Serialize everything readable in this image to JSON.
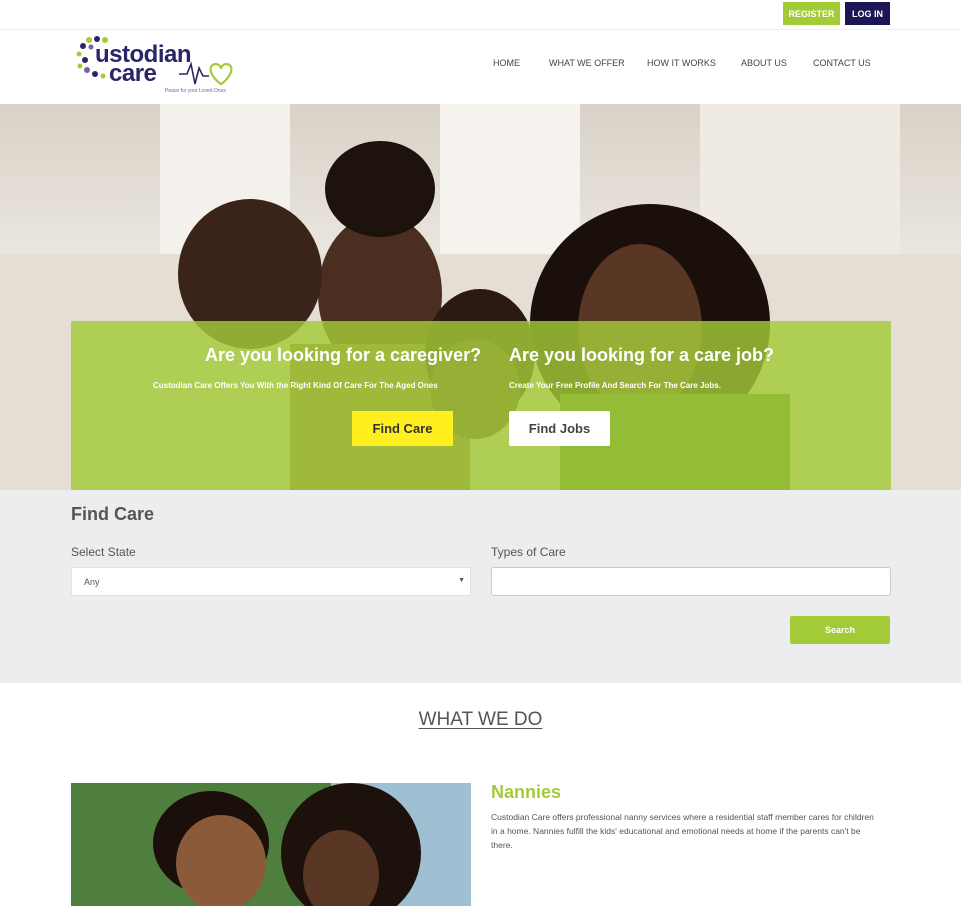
{
  "topbar": {
    "register_label": "REGISTER",
    "login_label": "LOG IN"
  },
  "logo": {
    "line1": "ustodian",
    "line2": "care",
    "tagline": "Peace for your Loved Ones"
  },
  "nav": {
    "items": [
      "HOME",
      "WHAT WE OFFER",
      "HOW IT WORKS",
      "ABOUT US",
      "CONTACT US"
    ]
  },
  "hero": {
    "caregiver_heading": "Are you looking for a caregiver?",
    "caregiver_sub": "Custodian Care Offers You With the Right Kind Of Care For The Aged Ones",
    "find_care_label": "Find Care",
    "job_heading": "Are you looking for a care job?",
    "job_sub": "Create Your Free Profile And Search For The Care Jobs.",
    "find_jobs_label": "Find Jobs"
  },
  "search": {
    "title": "Find Care",
    "state_label": "Select State",
    "state_value": "Any",
    "types_label": "Types of Care",
    "types_value": "",
    "search_label": "Search"
  },
  "what_we_do": {
    "title": "WHAT WE DO",
    "nannies_title": "Nannies",
    "nannies_text": "Custodian Care offers professional nanny services where a residential staff member cares for children in a home. Nannies fulfill the kids' educational and emotional needs at home if the parents can't be there."
  },
  "colors": {
    "accent_green": "#a3cb38",
    "navy": "#1c1654",
    "yellow": "#ffef1f"
  }
}
